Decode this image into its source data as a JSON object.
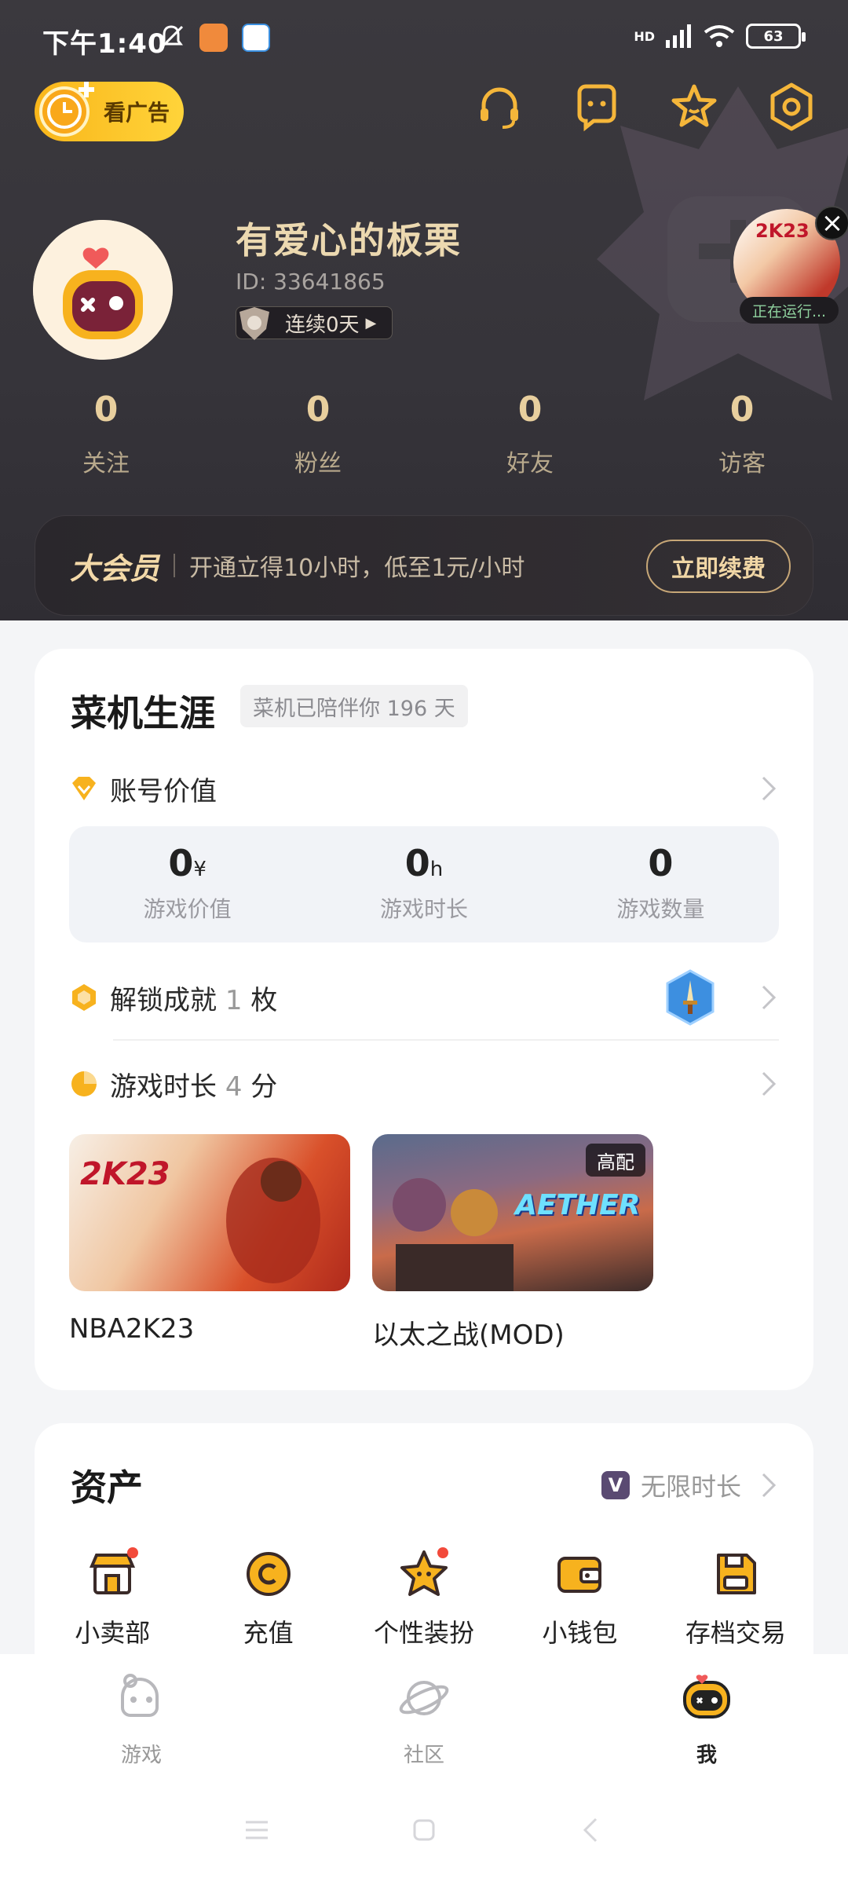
{
  "status_bar": {
    "time": "下午1:40",
    "battery": "63",
    "network": "HD"
  },
  "header": {
    "ad_label": "看广告",
    "icons": [
      "headset-icon",
      "chat-icon",
      "star-icon",
      "settings-icon"
    ],
    "user": {
      "name": "有爱心的板栗",
      "id": "ID:  33641865",
      "streak": "连续0天"
    },
    "running": {
      "label": "正在运行...",
      "thumb_text": "2K23"
    },
    "stats": [
      {
        "value": "0",
        "label": "关注"
      },
      {
        "value": "0",
        "label": "粉丝"
      },
      {
        "value": "0",
        "label": "好友"
      },
      {
        "value": "0",
        "label": "访客"
      }
    ],
    "vip": {
      "logo": "大会员",
      "text": "开通立得10小时，低至1元/小时",
      "button": "立即续费"
    }
  },
  "career": {
    "title": "菜机生涯",
    "tag": "菜机已陪伴你 196 天",
    "account_value": {
      "label": "账号价值"
    },
    "values": [
      {
        "value": "0",
        "unit": "¥",
        "label": "游戏价值"
      },
      {
        "value": "0",
        "unit": "h",
        "label": "游戏时长"
      },
      {
        "value": "0",
        "unit": "",
        "label": "游戏数量"
      }
    ],
    "achievement": {
      "prefix": "解锁成就",
      "count": "1",
      "suffix": "枚"
    },
    "playtime": {
      "prefix": "游戏时长",
      "count": "4",
      "suffix": "分"
    },
    "games": [
      {
        "title": "NBA2K23",
        "logo": "2K23",
        "badge": ""
      },
      {
        "title": "以太之战(MOD)",
        "logo": "AETHER",
        "badge": "高配"
      }
    ]
  },
  "assets": {
    "title": "资产",
    "right_label": "无限时长",
    "right_icon_letter": "V",
    "items": [
      {
        "label": "小卖部",
        "icon": "shop-icon"
      },
      {
        "label": "充值",
        "icon": "coin-icon"
      },
      {
        "label": "个性装扮",
        "icon": "dress-up-icon"
      },
      {
        "label": "小钱包",
        "icon": "wallet-icon"
      },
      {
        "label": "存档交易",
        "icon": "save-trade-icon"
      }
    ]
  },
  "bottom_nav": [
    {
      "label": "游戏",
      "icon": "game-icon"
    },
    {
      "label": "社区",
      "icon": "planet-icon"
    },
    {
      "label": "我",
      "icon": "me-icon"
    }
  ],
  "colors": {
    "accent": "#f9b61a",
    "hero_bg": "#3b393e",
    "gold_text": "#e8cf9e",
    "red_dot": "#f24a3b"
  }
}
